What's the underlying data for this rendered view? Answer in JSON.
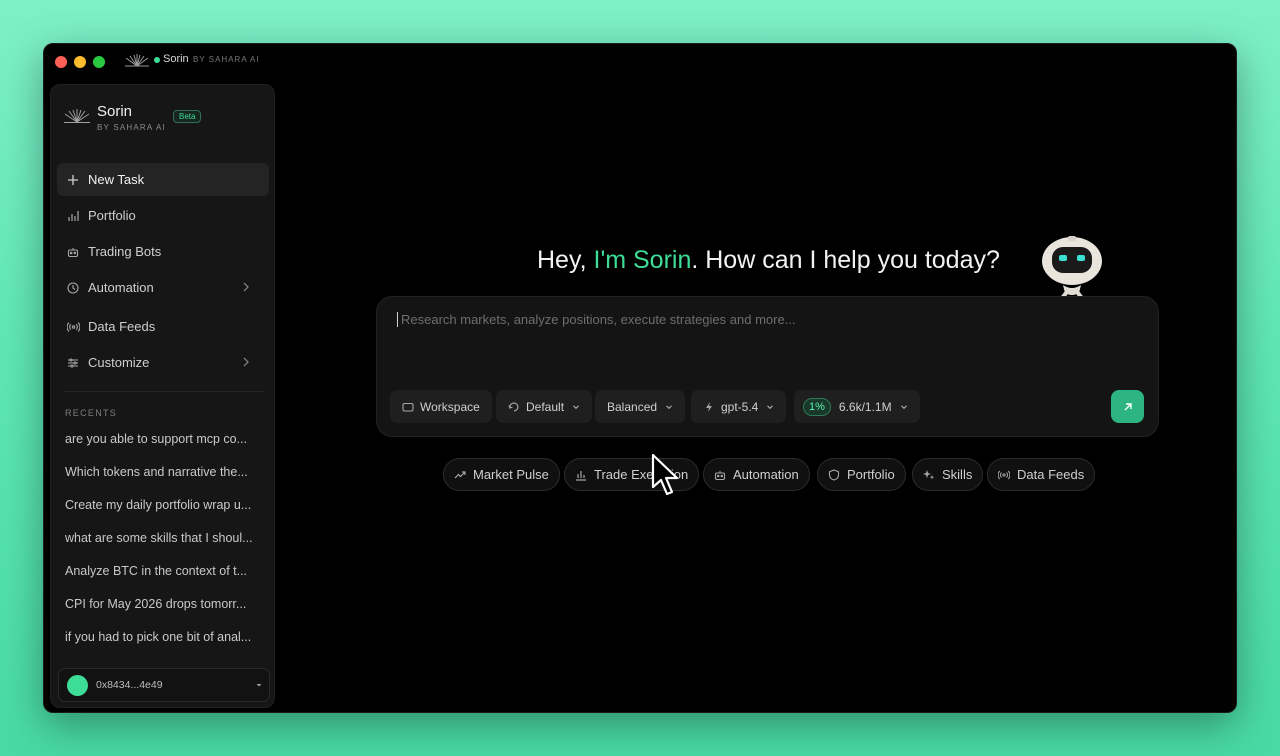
{
  "titlebar": {
    "app_name": "Sorin",
    "by_line": "BY SAHARA AI"
  },
  "sidebar": {
    "brand_name": "Sorin",
    "brand_by": "BY SAHARA AI",
    "beta_badge": "Beta",
    "nav": [
      {
        "label": "New Task",
        "icon": "plus-icon"
      },
      {
        "label": "Portfolio",
        "icon": "bar-chart-icon"
      },
      {
        "label": "Trading Bots",
        "icon": "bot-icon"
      },
      {
        "label": "Automation",
        "icon": "clock-icon"
      },
      {
        "label": "Data Feeds",
        "icon": "broadcast-icon"
      },
      {
        "label": "Customize",
        "icon": "sliders-icon"
      }
    ],
    "recents_label": "RECENTS",
    "recents": [
      "are you able to support mcp co...",
      "Which tokens and narrative the...",
      "Create my daily portfolio wrap u...",
      "what are some skills that I shoul...",
      "Analyze BTC in the context of t...",
      "CPI for May 2026 drops tomorr...",
      "if you had to pick one bit of anal..."
    ],
    "wallet_address": "0x8434...4e49"
  },
  "main": {
    "greeting_prefix": "Hey, ",
    "greeting_accent": "I'm Sorin",
    "greeting_suffix": ". How can I help you today?",
    "prompt_placeholder": "Research markets, analyze positions, execute strategies and more...",
    "toolbar": {
      "workspace": "Workspace",
      "mode": "Default",
      "balance": "Balanced",
      "model": "gpt-5.4",
      "context_percent": "1%",
      "context_tokens": "6.6k/1.1M"
    },
    "chips": [
      "Market Pulse",
      "Trade Execution",
      "Automation",
      "Portfolio",
      "Skills",
      "Data Feeds"
    ]
  },
  "colors": {
    "accent": "#3ddc97",
    "send_button": "#2cb583",
    "background": "#000000"
  }
}
